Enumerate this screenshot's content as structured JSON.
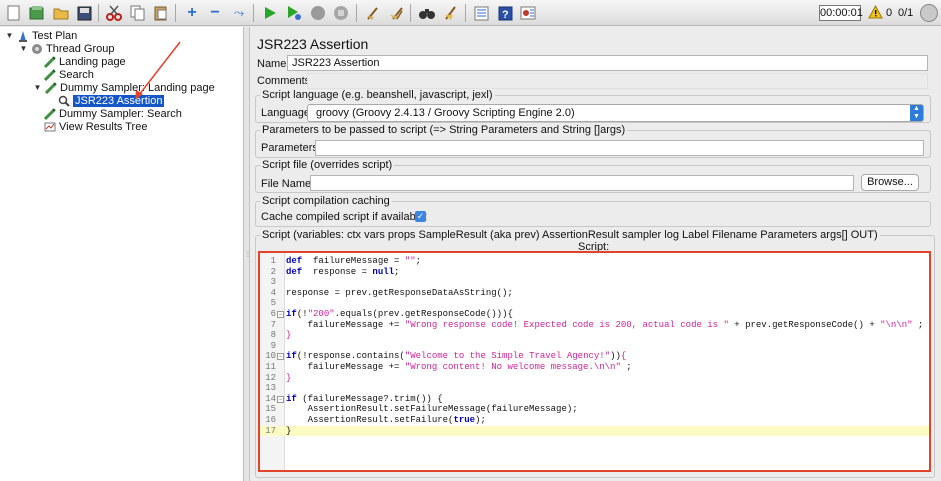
{
  "toolbar": {
    "timer": "00:00:01",
    "warning_count": "0",
    "threads": "0/1",
    "buttons": [
      "new-icon",
      "templates-icon",
      "open-icon",
      "save-icon",
      "cut-icon",
      "copy-icon",
      "paste-icon",
      "expand-icon",
      "collapse-icon",
      "toggle-icon",
      "start-icon",
      "start-no-pause-icon",
      "stop-icon",
      "shutdown-icon",
      "clear-icon",
      "clear-all-icon",
      "search-icon",
      "reset-search-icon",
      "function-helper-icon",
      "help-icon",
      "remote-icon"
    ]
  },
  "tree": {
    "items": [
      {
        "label": "Test Plan",
        "icon": "test-plan-icon"
      },
      {
        "label": "Thread Group",
        "icon": "thread-group-icon"
      },
      {
        "label": "Landing page",
        "icon": "sampler-icon"
      },
      {
        "label": "Search",
        "icon": "sampler-icon"
      },
      {
        "label": "Dummy Sampler: Landing page",
        "icon": "sampler-icon"
      },
      {
        "label": "JSR223 Assertion",
        "icon": "assertion-icon"
      },
      {
        "label": "Dummy Sampler: Search",
        "icon": "sampler-icon"
      },
      {
        "label": "View Results Tree",
        "icon": "listener-icon"
      }
    ]
  },
  "form": {
    "title": "JSR223 Assertion",
    "name_label": "Name:",
    "name_value": "JSR223 Assertion",
    "comments_label": "Comments:",
    "language_group": "Script language (e.g. beanshell, javascript, jexl)",
    "language_label": "Language:",
    "language_value": "groovy     (Groovy 2.4.13 / Groovy Scripting Engine 2.0)",
    "params_group": "Parameters to be passed to script (=> String Parameters and String []args)",
    "params_label": "Parameters:",
    "file_group": "Script file (overrides script)",
    "file_label": "File Name:",
    "browse_label": "Browse...",
    "cache_group": "Script compilation caching",
    "cache_label": "Cache compiled script if available:",
    "cache_checked": true,
    "script_group": "Script (variables: ctx vars props SampleResult (aka prev) AssertionResult sampler log Label Filename Parameters args[] OUT)",
    "script_label": "Script:"
  },
  "script": {
    "lines": [
      {
        "n": "1",
        "fold": "",
        "tokens": [
          [
            "kw",
            "def"
          ],
          [
            "",
            "  failureMessage = "
          ],
          [
            "str",
            "\"\""
          ],
          [
            "",
            ";"
          ]
        ]
      },
      {
        "n": "2",
        "fold": "",
        "tokens": [
          [
            "kw",
            "def"
          ],
          [
            "",
            "  response = "
          ],
          [
            "kw",
            "null"
          ],
          [
            "",
            ";"
          ]
        ]
      },
      {
        "n": "3",
        "fold": "",
        "tokens": []
      },
      {
        "n": "4",
        "fold": "",
        "tokens": [
          [
            "",
            "response = prev.getResponseDataAsString();"
          ]
        ]
      },
      {
        "n": "5",
        "fold": "",
        "tokens": []
      },
      {
        "n": "6",
        "fold": "−",
        "tokens": [
          [
            "kw",
            "if"
          ],
          [
            "",
            "(!"
          ],
          [
            "str",
            "\"200\""
          ],
          [
            "",
            ".equals(prev.getResponseCode())){"
          ]
        ]
      },
      {
        "n": "7",
        "fold": "",
        "tokens": [
          [
            "",
            "    failureMessage += "
          ],
          [
            "str",
            "\"Wrong response code! Expected code is 200, actual code is \""
          ],
          [
            "",
            " + prev.getResponseCode() + "
          ],
          [
            "str",
            "\"\\n\\n\""
          ],
          [
            "",
            " ;"
          ]
        ]
      },
      {
        "n": "8",
        "fold": "",
        "tokens": [
          [
            "str",
            "}"
          ]
        ]
      },
      {
        "n": "9",
        "fold": "",
        "tokens": []
      },
      {
        "n": "10",
        "fold": "−",
        "tokens": [
          [
            "kw",
            "if"
          ],
          [
            "",
            "(!response.contains("
          ],
          [
            "str",
            "\"Welcome to the Simple Travel Agency!\""
          ],
          [
            "",
            "))"
          ],
          [
            "str",
            "{"
          ]
        ]
      },
      {
        "n": "11",
        "fold": "",
        "tokens": [
          [
            "",
            "    failureMessage += "
          ],
          [
            "str",
            "\"Wrong content! No welcome message.\\n\\n\""
          ],
          [
            "",
            " ;"
          ]
        ]
      },
      {
        "n": "12",
        "fold": "",
        "tokens": [
          [
            "str",
            "}"
          ]
        ]
      },
      {
        "n": "13",
        "fold": "",
        "tokens": []
      },
      {
        "n": "14",
        "fold": "−",
        "tokens": [
          [
            "kw",
            "if"
          ],
          [
            "",
            " (failureMessage?.trim()) {"
          ]
        ]
      },
      {
        "n": "15",
        "fold": "",
        "tokens": [
          [
            "",
            "    AssertionResult.setFailureMessage(failureMessage);"
          ]
        ]
      },
      {
        "n": "16",
        "fold": "",
        "tokens": [
          [
            "",
            "    AssertionResult.setFailure("
          ],
          [
            "kw",
            "true"
          ],
          [
            "",
            ");"
          ]
        ]
      },
      {
        "n": "17",
        "fold": "",
        "tokens": [
          [
            "",
            "}"
          ]
        ]
      }
    ],
    "current_line": "17"
  },
  "colors": {
    "selection": "#1455c8",
    "highlight_border": "#e2432b",
    "keyword": "#0000b3",
    "string": "#d0229a"
  }
}
